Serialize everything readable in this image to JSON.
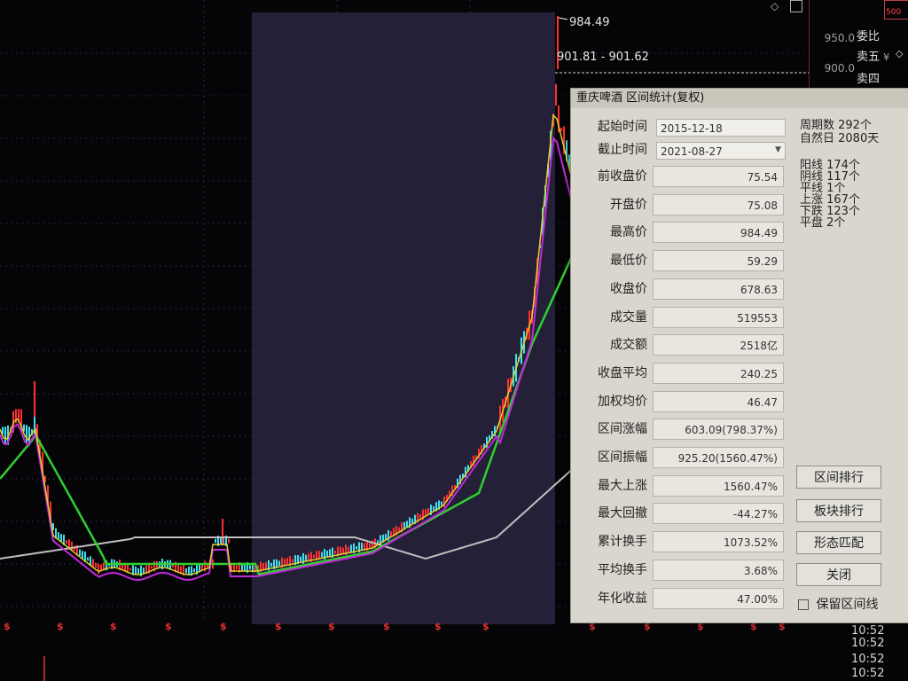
{
  "chart": {
    "peak_price": "984.49",
    "range_readout": "901.81 - 901.62"
  },
  "quote_panel": {
    "prices": [
      "950.0",
      "900.0"
    ],
    "rows": [
      "委比",
      "卖五",
      "卖四"
    ],
    "rows_suffix": "¥",
    "badge": "500"
  },
  "times": [
    "10:52",
    "10:52",
    "10:52",
    "10:52"
  ],
  "dialog": {
    "title": "重庆啤酒 区间统计(复权)",
    "start_label": "起始时间",
    "start_value": "2015-12-18",
    "end_label": "截止时间",
    "end_value": "2021-08-27",
    "period_stats": [
      "周期数 292个",
      "自然日 2080天"
    ],
    "candle_stats": [
      "阳线 174个",
      "阴线 117个",
      "平线 1个",
      "上涨 167个",
      "下跌 123个",
      "平盘 2个"
    ],
    "fields": [
      {
        "label": "前收盘价",
        "value": "75.54"
      },
      {
        "label": "开盘价",
        "value": "75.08"
      },
      {
        "label": "最高价",
        "value": "984.49"
      },
      {
        "label": "最低价",
        "value": "59.29"
      },
      {
        "label": "收盘价",
        "value": "678.63"
      },
      {
        "label": "成交量",
        "value": "519553"
      },
      {
        "label": "成交额",
        "value": "2518亿"
      },
      {
        "label": "收盘平均",
        "value": "240.25"
      },
      {
        "label": "加权均价",
        "value": "46.47"
      },
      {
        "label": "区间涨幅",
        "value": "603.09(798.37%)"
      },
      {
        "label": "区间振幅",
        "value": "925.20(1560.47%)"
      },
      {
        "label": "最大上涨",
        "value": "1560.47%"
      },
      {
        "label": "最大回撤",
        "value": "-44.27%"
      },
      {
        "label": "累计换手",
        "value": "1073.52%"
      },
      {
        "label": "平均换手",
        "value": "3.68%"
      },
      {
        "label": "年化收益",
        "value": "47.00%"
      }
    ],
    "buttons": [
      "区间排行",
      "板块排行",
      "形态匹配",
      "关闭"
    ],
    "checkbox_label": "保留区间线"
  },
  "colors": {
    "background": "#050508",
    "selection": "#2a2640",
    "ma_green": "#2fd02f",
    "ma_purple": "#c02bd8",
    "ma_yellow": "#e0d030",
    "ma_white": "#bfbfbf",
    "candle_red": "#ff3030",
    "candle_cyan": "#40e0f0",
    "annotation_red": "#e81818"
  }
}
